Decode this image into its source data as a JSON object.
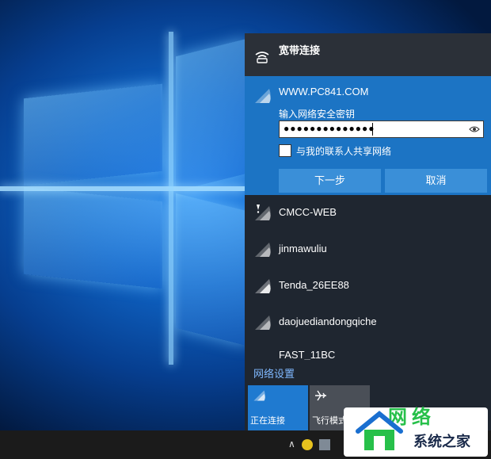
{
  "colors": {
    "flyout_bg": "#1f2630",
    "selected_bg": "#1c74c4",
    "button_bg": "#3a8fd8",
    "link": "#7fb8ff",
    "active_tile": "#1f7ad0",
    "inactive_tile": "#4a4f57",
    "taskbar": "#1b1b1b"
  },
  "broadband": {
    "icon": "dialup-icon",
    "label": "宽带连接"
  },
  "selected_network": {
    "icon": "wifi-icon",
    "ssid": "WWW.PC841.COM",
    "prompt": "输入网络安全密钥",
    "password_mask": "●●●●●●●●●●●●●●",
    "reveal_icon": "eye-icon",
    "share_label": "与我的联系人共享网络",
    "share_checked": false,
    "next_button": "下一步",
    "cancel_button": "取消"
  },
  "networks": [
    {
      "icon": "wifi-secured-warning-icon",
      "ssid": "CMCC-WEB"
    },
    {
      "icon": "wifi-icon",
      "ssid": "jinmawuliu"
    },
    {
      "icon": "wifi-icon",
      "ssid": "Tenda_26EE88"
    },
    {
      "icon": "wifi-icon",
      "ssid": "daojuediandongqiche"
    },
    {
      "icon": "wifi-icon",
      "ssid": "FAST_11BC"
    }
  ],
  "settings_link": "网络设置",
  "quick_actions": [
    {
      "icon": "wifi-icon",
      "label": "正在连接",
      "active": true
    },
    {
      "icon": "airplane-icon",
      "label": "飞行模式",
      "active": false
    }
  ],
  "watermark": {
    "brand": "系统之家",
    "partial": "网络"
  }
}
